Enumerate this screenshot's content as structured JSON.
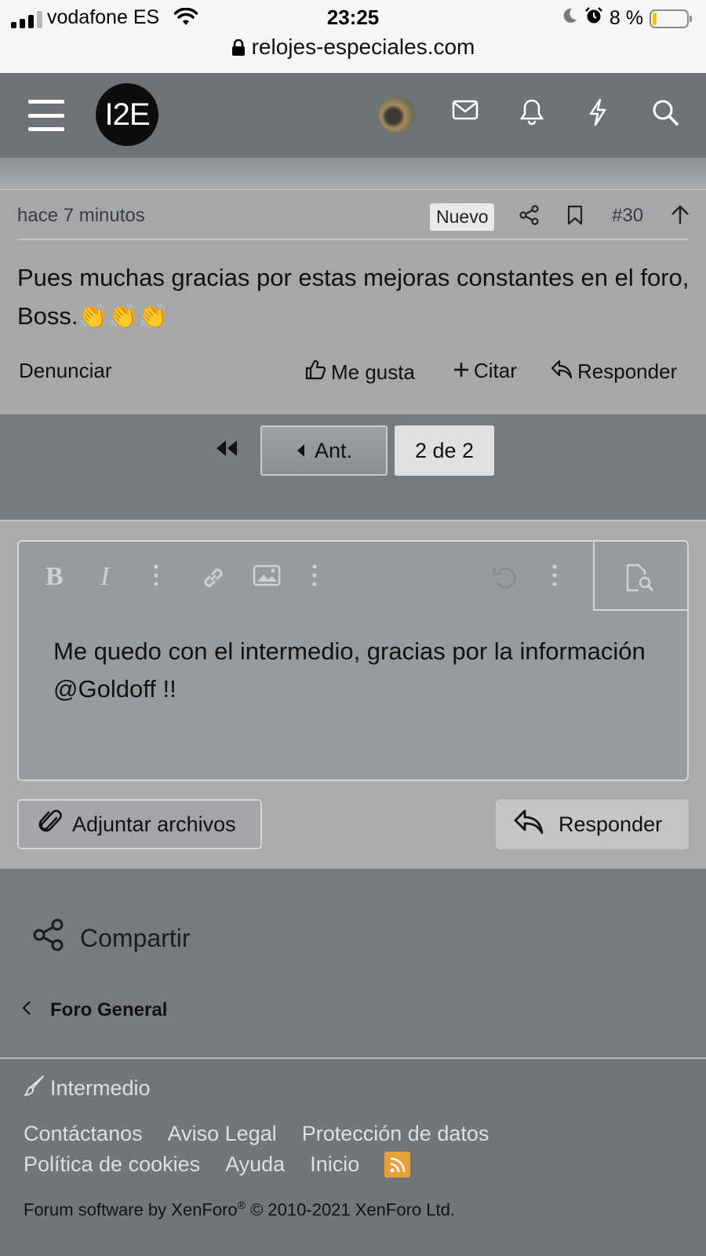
{
  "status_bar": {
    "carrier": "vodafone ES",
    "time": "23:25",
    "battery": "8 %",
    "battery_level": 0.08
  },
  "browser": {
    "url": "relojes-especiales.com"
  },
  "header": {
    "logo_text": "I2E",
    "icons": [
      "menu-icon",
      "avatar",
      "envelope-icon",
      "bell-icon",
      "bolt-icon",
      "search-icon"
    ]
  },
  "post": {
    "time": "hace 7 minutos",
    "badge": "Nuevo",
    "number": "#30",
    "body": "Pues muchas gracias por estas mejoras constantes en el foro, Boss.👏👏👏",
    "actions": {
      "report": "Denunciar",
      "like": "Me gusta",
      "quote": "Citar",
      "reply": "Responder"
    }
  },
  "pagination": {
    "prev": "Ant.",
    "current": "2 de 2"
  },
  "editor": {
    "text": "Me quedo con el intermedio, gracias por la información @Goldoff !!",
    "attach_label": "Adjuntar archivos",
    "reply_label": "Responder"
  },
  "share": {
    "label": "Compartir"
  },
  "breadcrumb": {
    "label": "Foro General"
  },
  "footer": {
    "style_label": "Intermedio",
    "links_row1": [
      "Contáctanos",
      "Aviso Legal",
      "Protección de datos"
    ],
    "links_row2": [
      "Política de cookies",
      "Ayuda",
      "Inicio"
    ],
    "copyright_prefix": "Forum software by XenForo",
    "copyright_mark": "®",
    "copyright_suffix": " © 2010-2021 XenForo Ltd."
  }
}
